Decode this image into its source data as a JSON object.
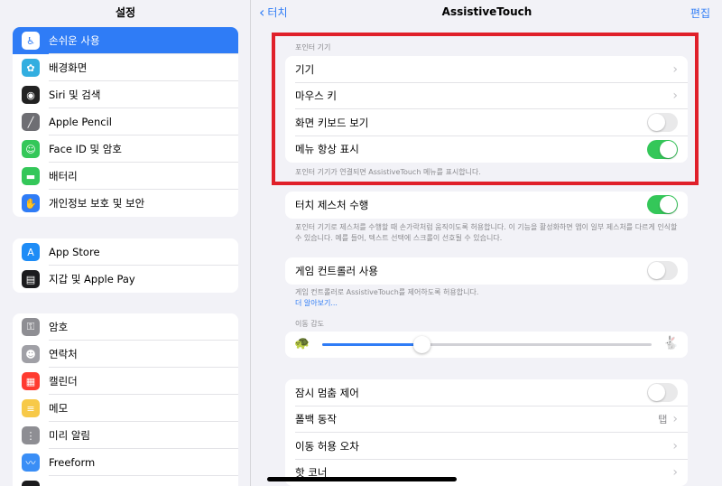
{
  "sidebar": {
    "title": "설정",
    "group1": [
      {
        "label": "손쉬운 사용",
        "icon": "accessibility-icon",
        "color": "#2f7cf6",
        "glyph": "♿",
        "selected": true
      },
      {
        "label": "배경화면",
        "icon": "wallpaper-icon",
        "color": "#32aee0",
        "glyph": "✿"
      },
      {
        "label": "Siri 및 검색",
        "icon": "siri-icon",
        "color": "#222222",
        "glyph": "◉"
      },
      {
        "label": "Apple Pencil",
        "icon": "pencil-icon",
        "color": "#6e6e73",
        "glyph": "╱"
      },
      {
        "label": "Face ID 및 암호",
        "icon": "faceid-icon",
        "color": "#34c759",
        "glyph": "☺"
      },
      {
        "label": "배터리",
        "icon": "battery-icon",
        "color": "#34c759",
        "glyph": "▬"
      },
      {
        "label": "개인정보 보호 및 보안",
        "icon": "privacy-hand-icon",
        "color": "#2f7cf6",
        "glyph": "✋"
      }
    ],
    "group2": [
      {
        "label": "App Store",
        "icon": "appstore-icon",
        "color": "#1e8cf6",
        "glyph": "A"
      },
      {
        "label": "지갑 및 Apple Pay",
        "icon": "wallet-icon",
        "color": "#1c1c1e",
        "glyph": "▤"
      }
    ],
    "group3": [
      {
        "label": "암호",
        "icon": "key-icon",
        "color": "#8e8e93",
        "glyph": "⚿"
      },
      {
        "label": "연락처",
        "icon": "contacts-icon",
        "color": "#a0a0a6",
        "glyph": "☻"
      },
      {
        "label": "캘린더",
        "icon": "calendar-icon",
        "color": "#ff3b30",
        "glyph": "▦"
      },
      {
        "label": "메모",
        "icon": "notes-icon",
        "color": "#f7c948",
        "glyph": "≡"
      },
      {
        "label": "미리 알림",
        "icon": "reminders-icon",
        "color": "#8e8e93",
        "glyph": "⋮"
      },
      {
        "label": "Freeform",
        "icon": "freeform-icon",
        "color": "#3a8ef6",
        "glyph": "〰"
      },
      {
        "label": "",
        "icon": "partial-icon",
        "color": "#1c1c1e",
        "glyph": ""
      }
    ]
  },
  "nav": {
    "back_label": "터치",
    "title": "AssistiveTouch",
    "edit_label": "편집"
  },
  "pointer": {
    "header": "포인터 기기",
    "rows": [
      {
        "label": "기기",
        "type": "chevron"
      },
      {
        "label": "마우스 키",
        "type": "chevron"
      },
      {
        "label": "화면 키보드 보기",
        "type": "toggle",
        "on": false
      },
      {
        "label": "메뉴 항상 표시",
        "type": "toggle",
        "on": true
      }
    ],
    "footer": "포인터 기기가 연결되면 AssistiveTouch 메뉴를 표시합니다."
  },
  "gestures": {
    "label": "터치 제스처 수행",
    "on": true,
    "footer": "포인터 기기로 제스처를 수행할 때 손가락처럼 움직이도록 허용합니다. 이 기능을 활성화하면 앱이 일부 제스처를 다르게 인식할 수 있습니다. 예를 들어, 텍스트 선택에 스크롤이 선호될 수 있습니다."
  },
  "game": {
    "label": "게임 컨트롤러 사용",
    "on": false,
    "footer": "게임 컨트롤러로 AssistiveTouch를 제어하도록 허용합니다.",
    "link": "더 알아보기..."
  },
  "sensitivity": {
    "header": "이동 감도",
    "level": 0.3
  },
  "dwell": {
    "rows": [
      {
        "label": "잠시 멈춤 제어",
        "type": "toggle",
        "on": false
      },
      {
        "label": "폴백 동작",
        "type": "chevron",
        "detail": "탭"
      },
      {
        "label": "이동 허용 오차",
        "type": "chevron"
      },
      {
        "label": "핫 코너",
        "type": "chevron"
      }
    ]
  }
}
